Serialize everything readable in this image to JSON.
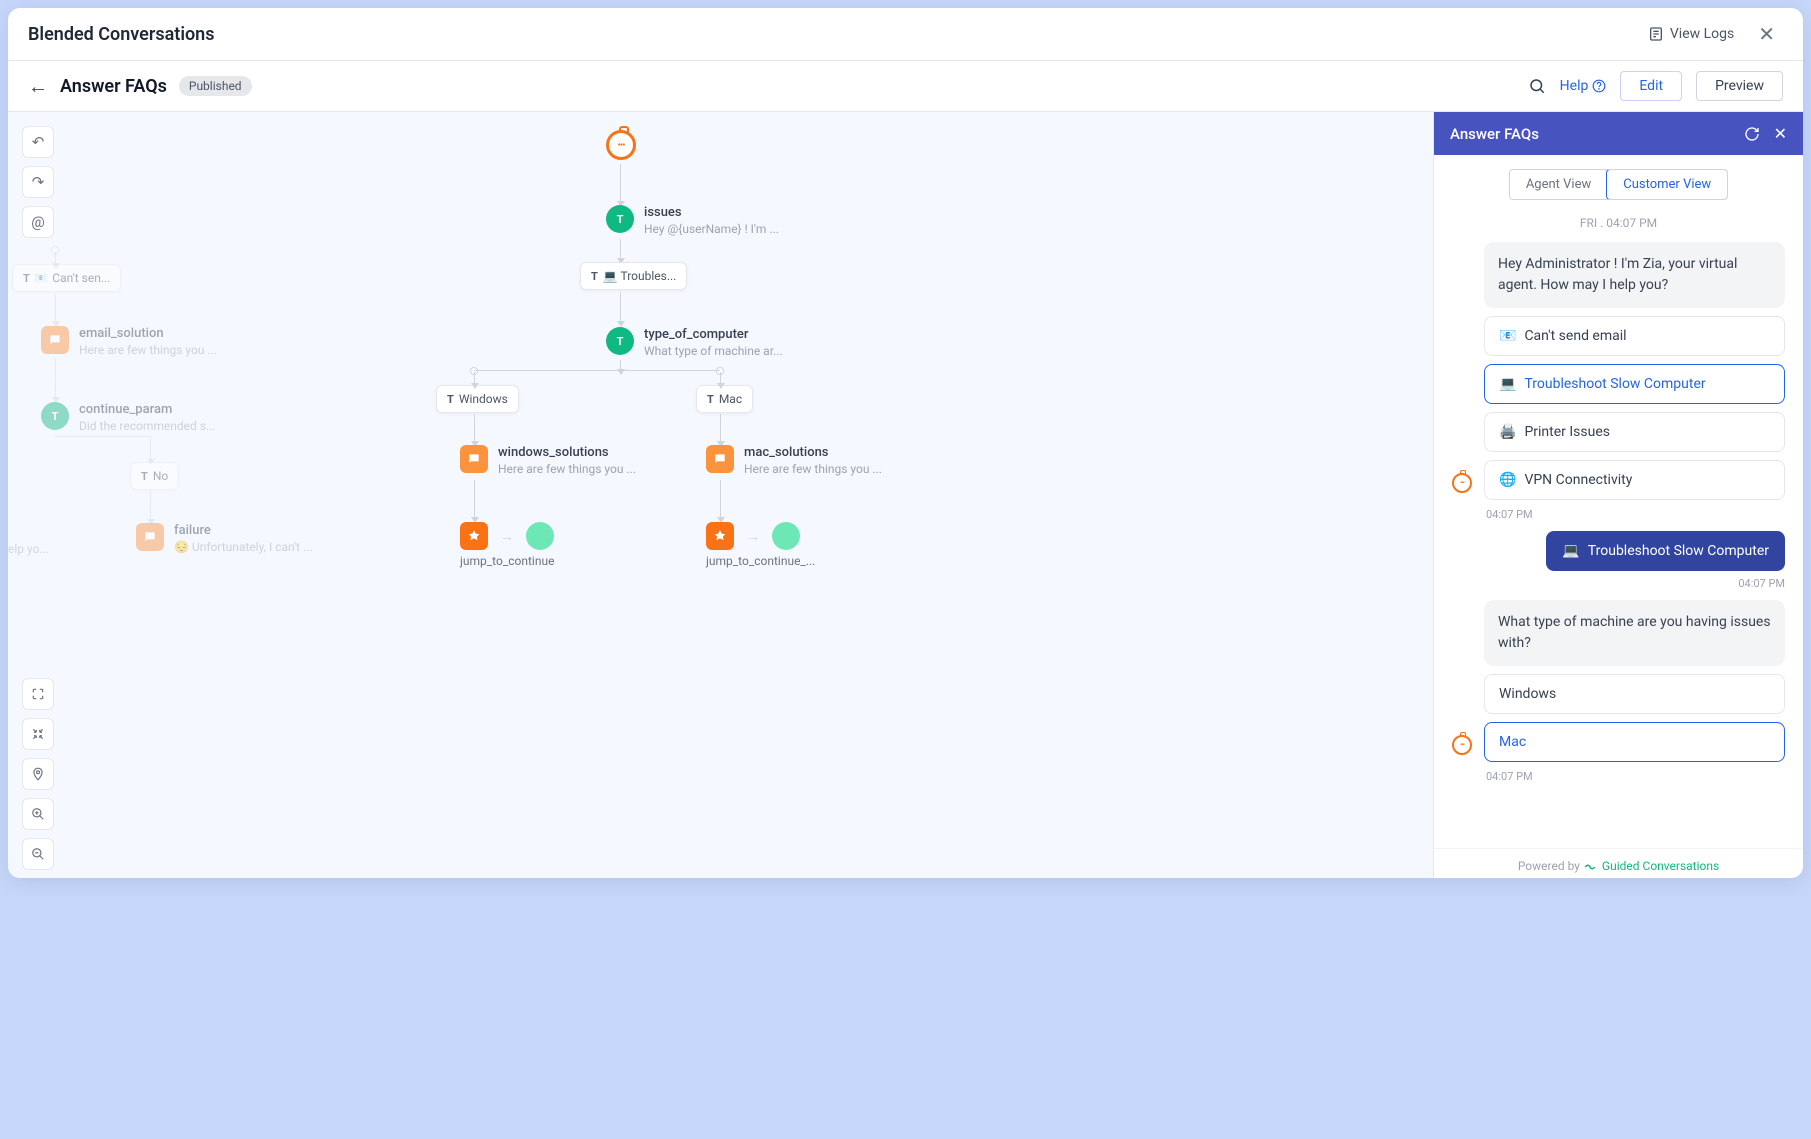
{
  "topbar": {
    "title": "Blended Conversations",
    "view_logs": "View Logs"
  },
  "subheader": {
    "title": "Answer FAQs",
    "badge": "Published",
    "help": "Help",
    "edit": "Edit",
    "preview": "Preview"
  },
  "flow": {
    "issues": {
      "title": "issues",
      "sub": "Hey  @{userName}  ! I'm ..."
    },
    "troubleshoot_pill": "💻 Troubles...",
    "type_of_computer": {
      "title": "type_of_computer",
      "sub": "What type of machine ar..."
    },
    "windows_pill": "Windows",
    "mac_pill": "Mac",
    "windows_solutions": {
      "title": "windows_solutions",
      "sub": "Here are few things you ..."
    },
    "mac_solutions": {
      "title": "mac_solutions",
      "sub": "Here are few things you ..."
    },
    "jump_continue": "jump_to_continue",
    "jump_continue_mac": "jump_to_continue_...",
    "cant_send_pill": "Can't sen...",
    "email_solution": {
      "title": "email_solution",
      "sub": "Here are few things you ..."
    },
    "continue_param": {
      "title": "continue_param",
      "sub": "Did the recommended s..."
    },
    "no_pill": "No",
    "failure": {
      "title": "failure",
      "sub": "😔 Unfortunately, I can't ..."
    },
    "elp_yo": "elp yo..."
  },
  "panel": {
    "title": "Answer FAQs",
    "agent_view": "Agent View",
    "customer_view": "Customer View",
    "date": "FRI . 04:07 PM",
    "greeting": "Hey Administrator ! I'm Zia, your virtual agent. How may I help you?",
    "options": [
      {
        "icon": "📧",
        "label": "Can't send email"
      },
      {
        "icon": "💻",
        "label": "Troubleshoot Slow Computer"
      },
      {
        "icon": "🖨️",
        "label": "Printer Issues"
      },
      {
        "icon": "🌐",
        "label": "VPN Connectivity"
      }
    ],
    "time1": "04:07 PM",
    "user_reply_icon": "💻",
    "user_reply": "Troubleshoot Slow Computer",
    "time2": "04:07 PM",
    "question2": "What type of machine are you having issues with?",
    "machine_options": [
      "Windows",
      "Mac"
    ],
    "time3": "04:07 PM",
    "footer_prefix": "Powered by",
    "footer_link": "Guided Conversations"
  }
}
